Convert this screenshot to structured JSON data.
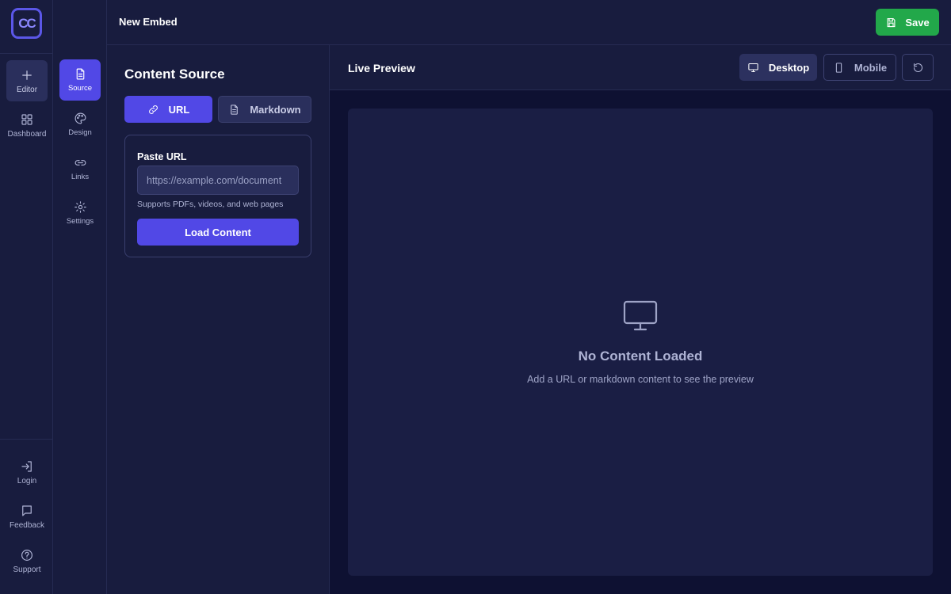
{
  "app": {
    "logo_text": "CC",
    "document_title": "New Embed",
    "save_label": "Save",
    "colors": {
      "accent": "#5148e6",
      "save": "#22a84a",
      "background": "#181c3e",
      "preview_background": "#0e1132"
    }
  },
  "rail": {
    "top_items": [
      {
        "label": "Editor",
        "icon": "plus-icon",
        "active": true
      },
      {
        "label": "Dashboard",
        "icon": "grid-icon",
        "active": false
      }
    ],
    "bottom_items": [
      {
        "label": "Login",
        "icon": "login-icon"
      },
      {
        "label": "Feedback",
        "icon": "chat-icon"
      },
      {
        "label": "Support",
        "icon": "help-icon"
      }
    ]
  },
  "subrail": {
    "items": [
      {
        "label": "Source",
        "icon": "document-icon",
        "active": true
      },
      {
        "label": "Design",
        "icon": "palette-icon",
        "active": false
      },
      {
        "label": "Links",
        "icon": "link-icon",
        "active": false
      },
      {
        "label": "Settings",
        "icon": "gear-icon",
        "active": false
      }
    ]
  },
  "content_source": {
    "title": "Content Source",
    "tabs": [
      {
        "label": "URL",
        "icon": "link-icon",
        "active": true
      },
      {
        "label": "Markdown",
        "icon": "document-icon",
        "active": false
      }
    ],
    "url_label": "Paste URL",
    "url_value": "",
    "url_placeholder": "https://example.com/document",
    "hint": "Supports PDFs, videos, and web pages",
    "load_label": "Load Content"
  },
  "preview": {
    "title": "Live Preview",
    "desktop_label": "Desktop",
    "mobile_label": "Mobile",
    "active_view": "Desktop",
    "empty_title": "No Content Loaded",
    "empty_subtitle": "Add a URL or markdown content to see the preview"
  }
}
